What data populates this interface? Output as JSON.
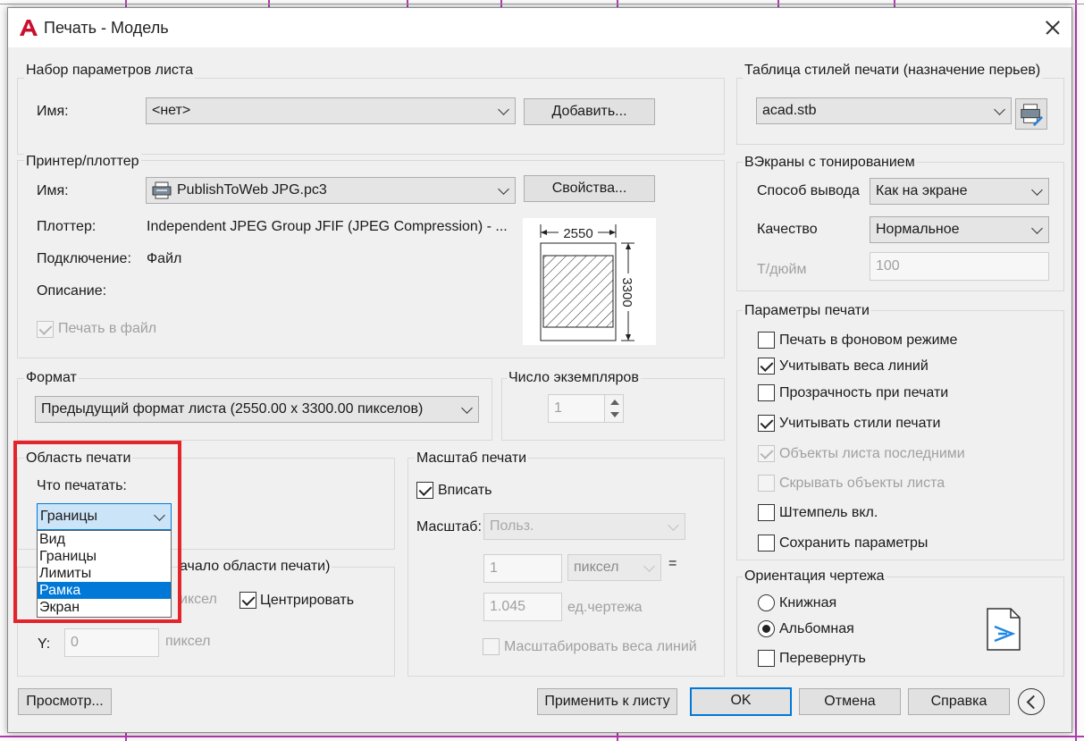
{
  "window": {
    "title": "Печать - Модель"
  },
  "page_setup": {
    "legend": "Набор параметров листа",
    "name_label": "Имя:",
    "name_value": "<нет>",
    "add_button": "Добавить..."
  },
  "printer": {
    "legend": "Принтер/плоттер",
    "name_label": "Имя:",
    "name_value": "PublishToWeb JPG.pc3",
    "properties_button": "Свойства...",
    "plotter_label": "Плоттер:",
    "plotter_value": "Independent JPEG Group JFIF (JPEG Compression) - ...",
    "connection_label": "Подключение:",
    "connection_value": "Файл",
    "description_label": "Описание:",
    "print_to_file_label": "Печать в файл",
    "print_to_file_checked": true,
    "preview_width": "2550",
    "preview_height": "3300"
  },
  "paper_size": {
    "legend": "Формат",
    "value": "Предыдущий формат листа  (2550.00 x 3300.00 пикселов)"
  },
  "copies": {
    "legend": "Число экземпляров",
    "value": "1"
  },
  "plot_area": {
    "legend": "Область печати",
    "what_label": "Что печатать:",
    "selected": "Границы",
    "options": [
      "Вид",
      "Границы",
      "Лимиты",
      "Рамка",
      "Экран"
    ],
    "highlighted_index": 3
  },
  "plot_offset": {
    "legend_visible": "ачало области печати)",
    "x_unit": "иксел",
    "y_label": "Y:",
    "y_value": "0",
    "y_unit": "пиксел",
    "center_label": "Центрировать",
    "center_checked": true
  },
  "plot_scale": {
    "legend": "Масштаб печати",
    "fit_label": "Вписать",
    "fit_checked": true,
    "scale_label": "Масштаб:",
    "scale_value": "Польз.",
    "value1": "1",
    "unit1": "пиксел",
    "equals": "=",
    "value2": "1.045",
    "unit2": "ед.чертежа",
    "lineweights_label": "Масштабировать веса линий",
    "lineweights_checked": false
  },
  "plot_style_table": {
    "legend": "Таблица стилей печати (назначение перьев)",
    "value": "acad.stb"
  },
  "shaded_viewport": {
    "legend": "ВЭкраны с тонированием",
    "shade_label": "Способ вывода",
    "shade_value": "Как на экране",
    "quality_label": "Качество",
    "quality_value": "Нормальное",
    "dpi_label": "Т/дюйм",
    "dpi_value": "100"
  },
  "plot_options": {
    "legend": "Параметры печати",
    "items": [
      {
        "label": "Печать в фоновом режиме",
        "checked": false,
        "disabled": false
      },
      {
        "label": "Учитывать веса линий",
        "checked": true,
        "disabled": false
      },
      {
        "label": "Прозрачность при печати",
        "checked": false,
        "disabled": false
      },
      {
        "label": "Учитывать стили печати",
        "checked": true,
        "disabled": false
      },
      {
        "label": "Объекты листа последними",
        "checked": true,
        "disabled": true
      },
      {
        "label": "Скрывать объекты листа",
        "checked": false,
        "disabled": true
      },
      {
        "label": "Штемпель вкл.",
        "checked": false,
        "disabled": false
      },
      {
        "label": "Сохранить параметры",
        "checked": false,
        "disabled": false
      }
    ]
  },
  "orientation": {
    "legend": "Ориентация чертежа",
    "portrait": "Книжная",
    "landscape": "Альбомная",
    "selected": "landscape",
    "upside_down": "Перевернуть",
    "upside_down_checked": false
  },
  "footer": {
    "preview": "Просмотр...",
    "apply": "Применить к листу",
    "ok": "OK",
    "cancel": "Отмена",
    "help": "Справка"
  },
  "colors": {
    "accent": "#0078d7",
    "highlight_box": "#e3242b",
    "autocad_red": "#c8102e"
  }
}
